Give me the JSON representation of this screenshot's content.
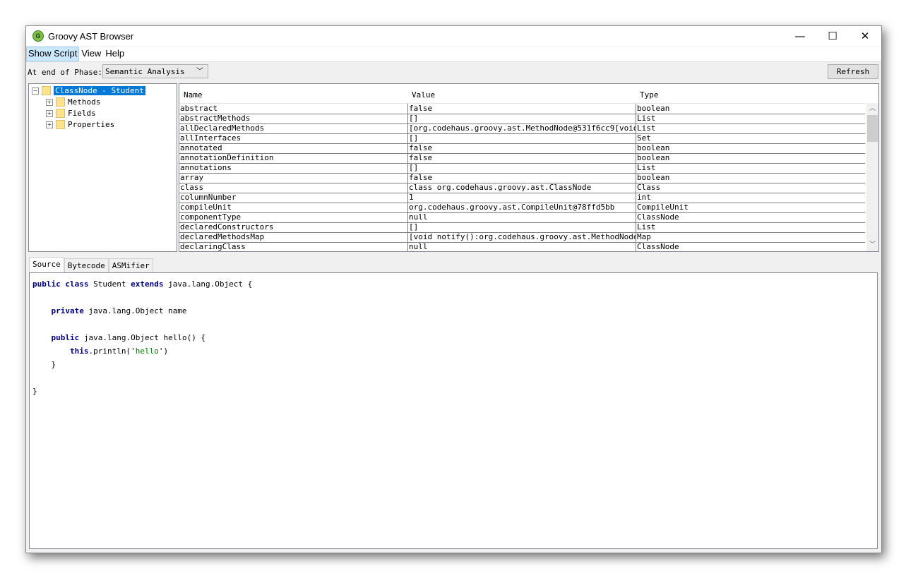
{
  "window": {
    "title": "Groovy AST Browser",
    "minimize": "—",
    "maximize": "☐",
    "close": "✕"
  },
  "menu": [
    {
      "label": "Show Script"
    },
    {
      "label": "View"
    },
    {
      "label": "Help"
    }
  ],
  "toolbar": {
    "phase_label": "At end of Phase:",
    "phase_value": "Semantic Analysis",
    "refresh_label": "Refresh"
  },
  "tree": {
    "root": "ClassNode - Student",
    "children": [
      "Methods",
      "Fields",
      "Properties"
    ]
  },
  "table": {
    "headers": [
      "Name",
      "Value",
      "Type"
    ],
    "rows": [
      [
        "abstract",
        "false",
        "boolean"
      ],
      [
        "abstractMethods",
        "[]",
        "List"
      ],
      [
        "allDeclaredMethods",
        "[org.codehaus.groovy.ast.MethodNode@531f6cc9[void ...",
        "List"
      ],
      [
        "allInterfaces",
        "[]",
        "Set"
      ],
      [
        "annotated",
        "false",
        "boolean"
      ],
      [
        "annotationDefinition",
        "false",
        "boolean"
      ],
      [
        "annotations",
        "[]",
        "List"
      ],
      [
        "array",
        "false",
        "boolean"
      ],
      [
        "class",
        "class org.codehaus.groovy.ast.ClassNode",
        "Class"
      ],
      [
        "columnNumber",
        "1",
        "int"
      ],
      [
        "compileUnit",
        "org.codehaus.groovy.ast.CompileUnit@78ffd5bb",
        "CompileUnit"
      ],
      [
        "componentType",
        "null",
        "ClassNode"
      ],
      [
        "declaredConstructors",
        "[]",
        "List"
      ],
      [
        "declaredMethodsMap",
        "[void notify():org.codehaus.groovy.ast.MethodNode@...",
        "Map"
      ],
      [
        "declaringClass",
        "null",
        "ClassNode"
      ]
    ]
  },
  "tabs": [
    {
      "label": "Source"
    },
    {
      "label": "Bytecode"
    },
    {
      "label": "ASMifier"
    }
  ],
  "source": [
    [
      [
        "kw",
        "public class"
      ],
      [
        "p",
        " Student "
      ],
      [
        "kw",
        "extends"
      ],
      [
        "p",
        " java.lang.Object {"
      ]
    ],
    [],
    [
      [
        "p",
        "    "
      ],
      [
        "kw",
        "private"
      ],
      [
        "p",
        " java.lang.Object name"
      ]
    ],
    [],
    [
      [
        "p",
        "    "
      ],
      [
        "kw",
        "public"
      ],
      [
        "p",
        " java.lang.Object hello() {"
      ]
    ],
    [
      [
        "p",
        "        "
      ],
      [
        "kw",
        "this"
      ],
      [
        "p",
        ".println('"
      ],
      [
        "str",
        "hello"
      ],
      [
        "p",
        "')"
      ]
    ],
    [
      [
        "p",
        "    }"
      ]
    ],
    [],
    [
      [
        "p",
        "}"
      ]
    ]
  ]
}
